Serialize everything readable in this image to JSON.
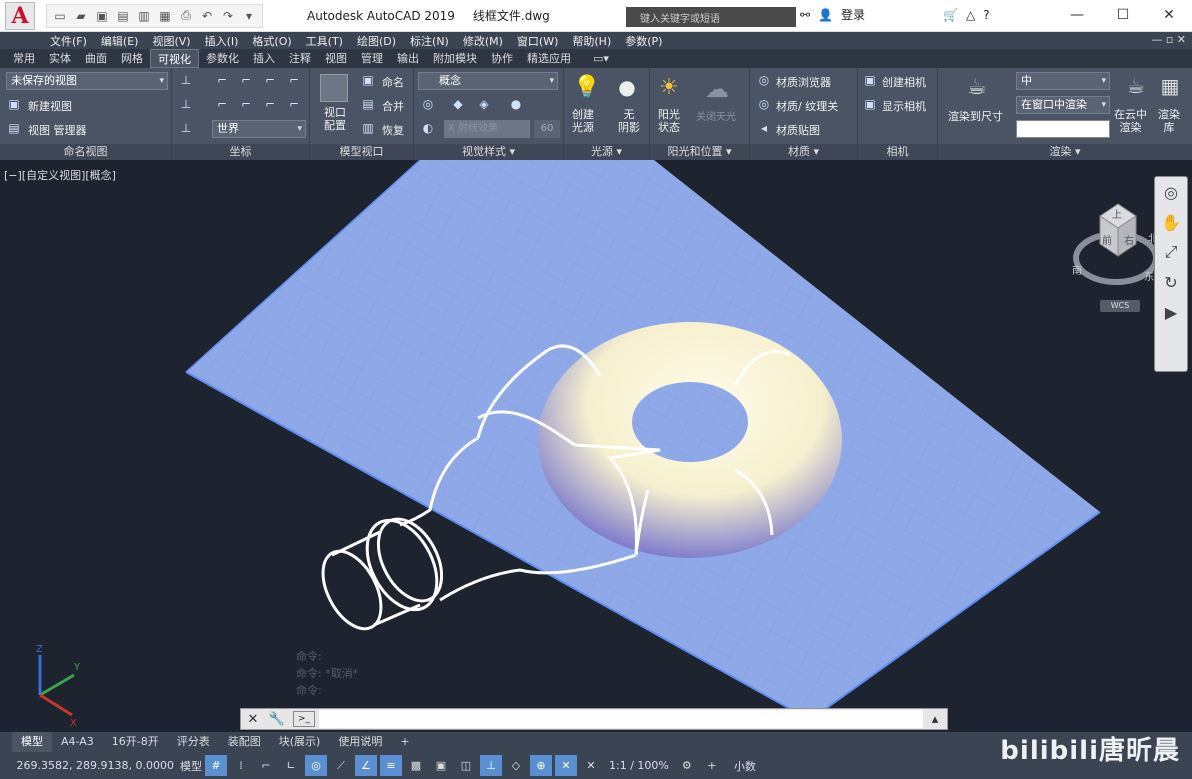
{
  "title": {
    "app": "Autodesk AutoCAD 2019",
    "file": "线框文件.dwg",
    "search_placeholder": "键入关键字或短语",
    "login": "登录"
  },
  "menubar": [
    "文件(F)",
    "编辑(E)",
    "视图(V)",
    "插入(I)",
    "格式(O)",
    "工具(T)",
    "绘图(D)",
    "标注(N)",
    "修改(M)",
    "窗口(W)",
    "帮助(H)",
    "参数(P)"
  ],
  "ribbon_tabs": [
    "常用",
    "实体",
    "曲面",
    "网格",
    "可视化",
    "参数化",
    "插入",
    "注释",
    "视图",
    "管理",
    "输出",
    "附加模块",
    "协作",
    "精选应用"
  ],
  "active_ribbon_tab": "可视化",
  "panels": {
    "named_views": {
      "title": "命名视图",
      "dropdown": "未保存的视图",
      "new_view": "新建视图",
      "manager": "视图 管理器"
    },
    "coords": {
      "title": "坐标",
      "ucs": "世界"
    },
    "model_viewports": {
      "title": "模型视口",
      "config": "视口\n配置",
      "name": "命名",
      "join": "合并",
      "restore": "恢复"
    },
    "visual_styles": {
      "title": "视觉样式 ▾",
      "style": "概念",
      "xray": "X 射线效果",
      "opacity": "60"
    },
    "lights": {
      "title": "光源 ▾",
      "create_light": "创建\n光源",
      "no_shadow": "无\n阴影"
    },
    "sun": {
      "title": "阳光和位置 ▾",
      "sun_status": "阳光\n状态",
      "sky": "关闭天光"
    },
    "materials": {
      "title": "材质 ▾",
      "browser": "材质浏览器",
      "mat_tex": "材质/ 纹理关",
      "mapping": "材质贴图"
    },
    "camera": {
      "title": "相机",
      "create": "创建相机",
      "show": "显示相机"
    },
    "render": {
      "title": "渲染 ▾",
      "render_size": "渲染到尺寸",
      "level": "中",
      "render_in": "在窗口中渲染",
      "cloud": "在云中\n渲染",
      "library": "渲染\n库"
    }
  },
  "viewport_label": "[−][自定义视图][概念]",
  "viewcube": {
    "top": "上",
    "front": "前",
    "right": "右",
    "north": "北",
    "south": "南",
    "east": "东",
    "wcs": "WCS"
  },
  "command_history": [
    "命令:",
    "命令: *取消*",
    "命令:"
  ],
  "layout_tabs": [
    "模型",
    "A4-A3",
    "16开-8开",
    "评分表",
    "装配图",
    "块(展示)",
    "使用说明"
  ],
  "active_layout": "模型",
  "status": {
    "coords": "269.3582, 289.9138, 0.0000",
    "model": "模型",
    "scale": "1:1 / 100%",
    "units": "小数"
  },
  "watermark": "bilibili唐昕晨",
  "colors": {
    "accent": "#5a8fd1",
    "plane": "#8fa9e8",
    "viewport_bg": "#1e2330"
  }
}
